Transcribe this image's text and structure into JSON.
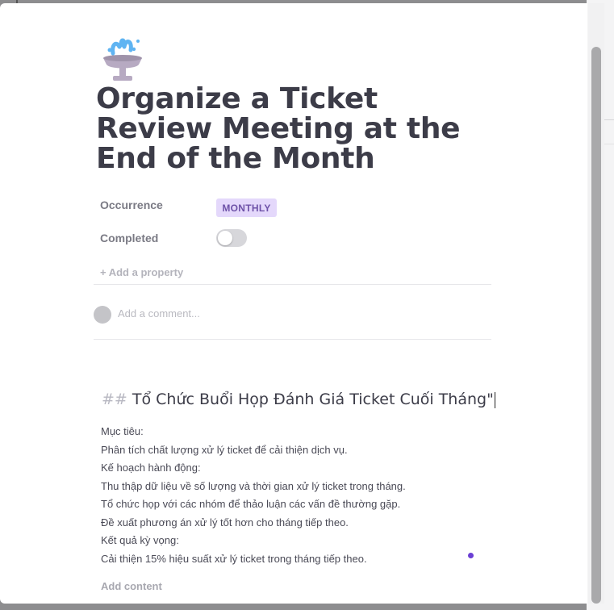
{
  "task": {
    "title": "Organize a Ticket Review Meeting at the End of the Month",
    "icon": "fountain-icon"
  },
  "properties": [
    {
      "label": "Occurrence",
      "value": "MONTHLY",
      "kind": "badge",
      "color": "#e4d8fb"
    },
    {
      "label": "Completed",
      "value": false,
      "kind": "toggle"
    }
  ],
  "add_property_label": "+ Add a property",
  "comment": {
    "placeholder": "Add a comment..."
  },
  "doc": {
    "heading_marker": "##",
    "heading": "Tổ Chức Buổi Họp Đánh Giá Ticket Cuối Tháng\"",
    "lines": [
      "Mục tiêu:",
      "Phân tích chất lượng xử lý ticket để cải thiện dịch vụ.",
      "Kế hoạch hành động:",
      "Thu thập dữ liệu về số lượng và thời gian xử lý ticket trong tháng.",
      "Tổ chức họp với các nhóm để thảo luận các vấn đề thường gặp.",
      "Đề xuất phương án xử lý tốt hơn cho tháng tiếp theo.",
      "Kết quả kỳ vọng:",
      "Cải thiện 15% hiệu suất xử lý ticket trong tháng tiếp theo."
    ]
  },
  "add_content_label": "Add content",
  "accent_color": "#6b3fd4"
}
